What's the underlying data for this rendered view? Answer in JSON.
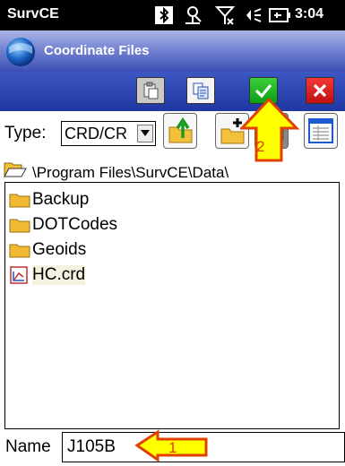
{
  "status_bar": {
    "app_name": "SurvCE",
    "time": "3:04",
    "icons": [
      "bluetooth-icon",
      "network-sync-icon",
      "no-signal-icon",
      "volume-icon",
      "battery-icon"
    ]
  },
  "title_bar": {
    "title": "Coordinate Files",
    "icon": "windows-start-icon"
  },
  "toolbar": {
    "buttons": [
      "paste-icon",
      "copy-icon",
      "ok-check-icon",
      "close-x-icon"
    ],
    "colors": {
      "ok": "#0fa61c",
      "cancel": "#dc1c1c",
      "bar": "#2a40b0"
    }
  },
  "type_row": {
    "label": "Type:",
    "selected": "CRD/CR",
    "buttons": [
      "folder-up-icon",
      "new-folder-icon",
      "detail-view-icon",
      "list-view-icon"
    ]
  },
  "path": {
    "value": "\\Program Files\\SurvCE\\Data\\"
  },
  "files": [
    {
      "name": "Backup",
      "type": "folder"
    },
    {
      "name": "DOTCodes",
      "type": "folder"
    },
    {
      "name": "Geoids",
      "type": "folder"
    },
    {
      "name": "HC.crd",
      "type": "file",
      "selected": true
    }
  ],
  "name_row": {
    "label": "Name",
    "value": "J105B"
  },
  "callouts": [
    {
      "number": "1",
      "color": "#e04000",
      "fill": "#ffff00"
    },
    {
      "number": "2",
      "color": "#e04000",
      "fill": "#ffff00"
    }
  ]
}
